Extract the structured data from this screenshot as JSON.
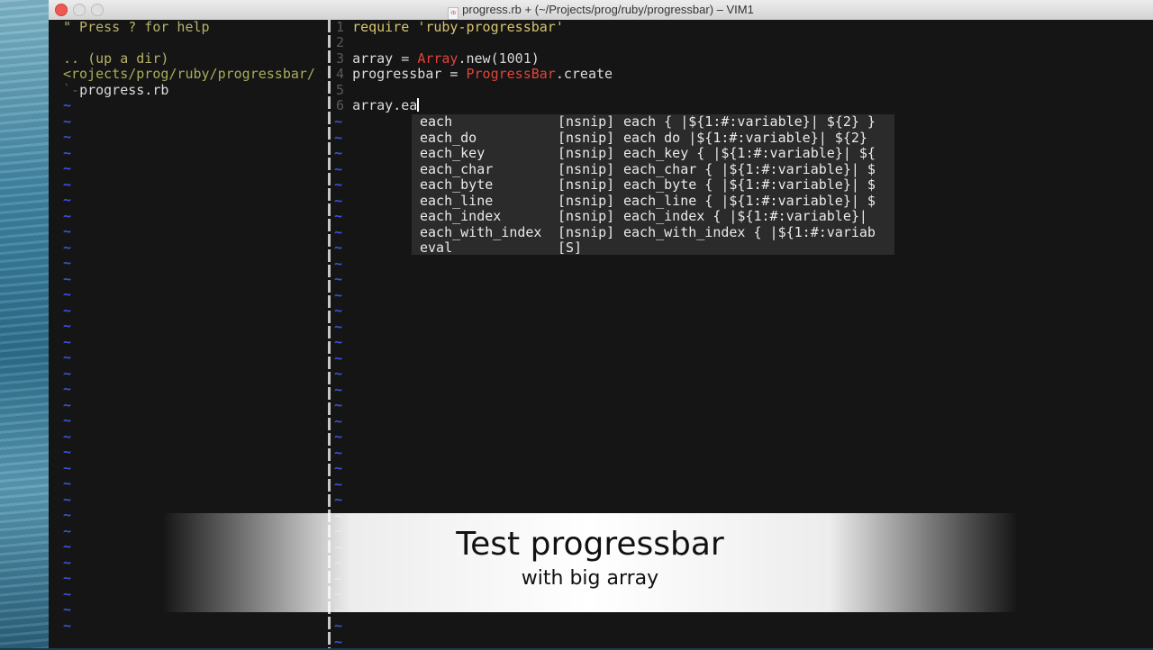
{
  "window": {
    "title": "progress.rb + (~/Projects/prog/ruby/progressbar) – VIM1",
    "file_icon_text": "rb"
  },
  "nerdtree": {
    "help": "\" Press ? for help",
    "up_dir": ".. (up a dir)",
    "cwd": "<rojects/prog/ruby/progressbar/",
    "file_prefix": "`-",
    "file": "progress.rb"
  },
  "tilde": "~",
  "code": {
    "line1": {
      "num": "1",
      "kw": "require ",
      "str": "'ruby-progressbar'"
    },
    "line2": {
      "num": "2"
    },
    "line3": {
      "num": "3",
      "a": "array = ",
      "const": "Array",
      "b": ".new(",
      "n": "1001",
      "c": ")"
    },
    "line4": {
      "num": "4",
      "a": "progressbar = ",
      "const": "ProgressBar",
      "b": ".create"
    },
    "line5": {
      "num": "5"
    },
    "line6": {
      "num": "6",
      "a": "array.ea"
    }
  },
  "completion": [
    {
      "word": "each",
      "kind": "[nsnip]",
      "menu": "each { |${1:#:variable}| ${2} }"
    },
    {
      "word": "each_do",
      "kind": "[nsnip]",
      "menu": "each do |${1:#:variable}| ${2}"
    },
    {
      "word": "each_key",
      "kind": "[nsnip]",
      "menu": "each_key { |${1:#:variable}| ${"
    },
    {
      "word": "each_char",
      "kind": "[nsnip]",
      "menu": "each_char { |${1:#:variable}| $"
    },
    {
      "word": "each_byte",
      "kind": "[nsnip]",
      "menu": "each_byte { |${1:#:variable}| $"
    },
    {
      "word": "each_line",
      "kind": "[nsnip]",
      "menu": "each_line { |${1:#:variable}| $"
    },
    {
      "word": "each_index",
      "kind": "[nsnip]",
      "menu": "each_index { |${1:#:variable}|"
    },
    {
      "word": "each_with_index",
      "kind": "[nsnip]",
      "menu": "each_with_index { |${1:#:variab"
    },
    {
      "word": "eval",
      "kind": "[S]",
      "menu": ""
    }
  ],
  "banner": {
    "title": "Test progressbar",
    "subtitle": "with big array"
  }
}
